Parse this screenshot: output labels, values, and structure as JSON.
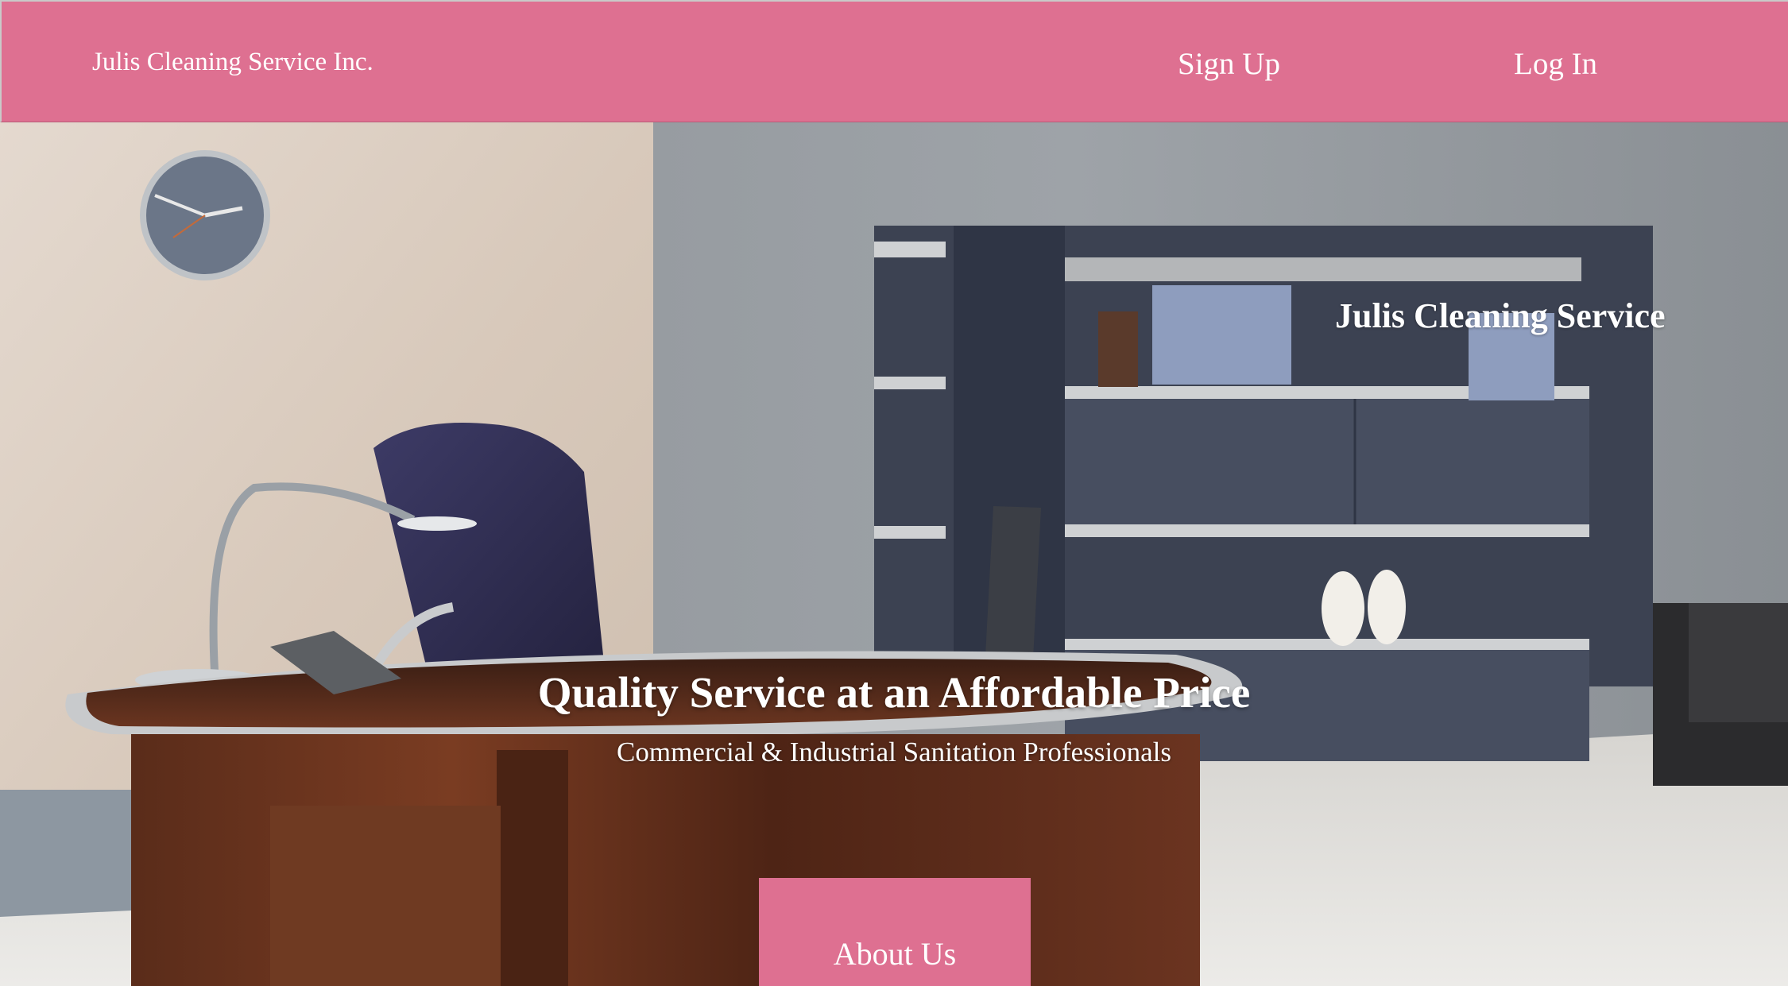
{
  "navbar": {
    "brand": "Julis Cleaning Service Inc.",
    "sign_up": "Sign Up",
    "log_in": "Log In"
  },
  "hero": {
    "brand": "Julis Cleaning Service",
    "headline": "Quality Service at an Affordable Price",
    "subheadline": "Commercial & Industrial Sanitation Professionals",
    "about_button": "About Us"
  },
  "colors": {
    "accent": "#de7091",
    "text": "#ffffff"
  }
}
